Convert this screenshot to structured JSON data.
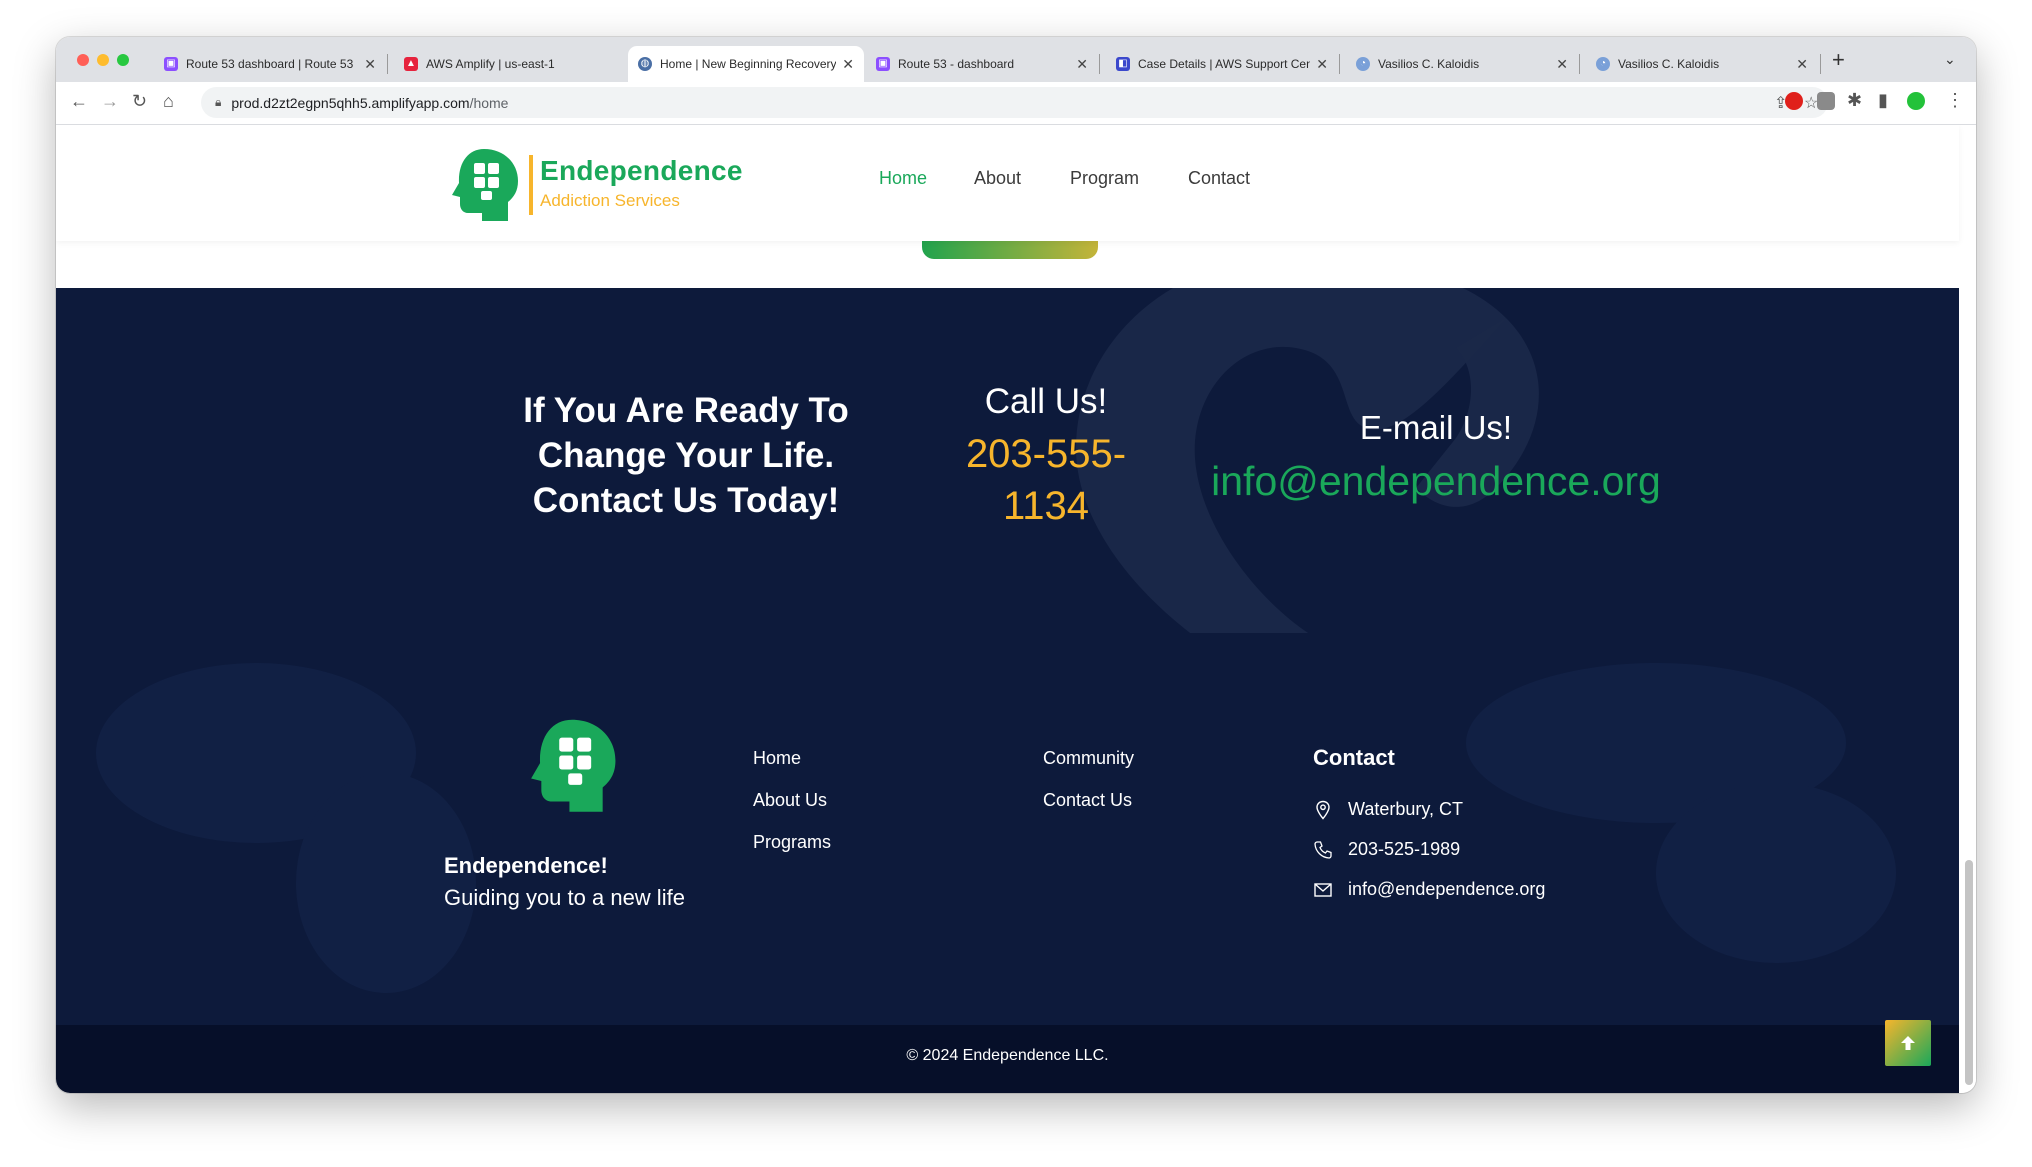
{
  "browser": {
    "tabs": [
      {
        "label": "Route 53 dashboard | Route 53",
        "favicon": "route53-icon",
        "color": "#8c4fff"
      },
      {
        "label": "AWS Amplify | us-east-1",
        "favicon": "amplify-icon",
        "color": "#e6233d"
      },
      {
        "label": "Home | New Beginning Recovery",
        "favicon": "globe-icon",
        "color": "#4a6fa5",
        "active": true
      },
      {
        "label": "Route 53 - dashboard",
        "favicon": "route53-icon",
        "color": "#8c4fff"
      },
      {
        "label": "Case Details | AWS Support Center",
        "favicon": "support-icon",
        "color": "#3b48cc"
      },
      {
        "label": "Vasilios C. Kaloidis",
        "favicon": "profile-icon",
        "color": "#7aa0d8"
      },
      {
        "label": "Vasilios C. Kaloidis",
        "favicon": "profile-icon",
        "color": "#7aa0d8"
      }
    ],
    "url_host": "prod.d2zt2egpn5qhh5.amplifyapp.com",
    "url_path": "/home"
  },
  "header": {
    "brand_title": "Endependence",
    "brand_subtitle": "Addiction Services",
    "nav": [
      {
        "label": "Home",
        "active": true
      },
      {
        "label": "About"
      },
      {
        "label": "Program"
      },
      {
        "label": "Contact"
      }
    ]
  },
  "cta": {
    "headline_lines": [
      "If You Are Ready To",
      "Change Your Life.",
      "Contact Us Today!"
    ],
    "call_label": "Call Us!",
    "phone_lines": [
      "203-555-",
      "1134"
    ],
    "email_label": "E-mail Us!",
    "email": "info@endependence.org"
  },
  "footer": {
    "brand": "Endependence!",
    "tagline": "Guiding you to a new life",
    "links_col1": [
      "Home",
      "About Us",
      "Programs"
    ],
    "links_col2": [
      "Community",
      "Contact Us"
    ],
    "contact_title": "Contact",
    "contact_items": [
      {
        "icon": "location-pin-icon",
        "text": "Waterbury, CT"
      },
      {
        "icon": "phone-icon",
        "text": "203-525-1989"
      },
      {
        "icon": "envelope-icon",
        "text": "info@endependence.org"
      }
    ],
    "copyright": "© 2024 Endependence LLC."
  },
  "colors": {
    "brand_green": "#1aa85a",
    "brand_yellow": "#f7b52c",
    "navy": "#0d1a3b",
    "navy_dark": "#060f29"
  }
}
